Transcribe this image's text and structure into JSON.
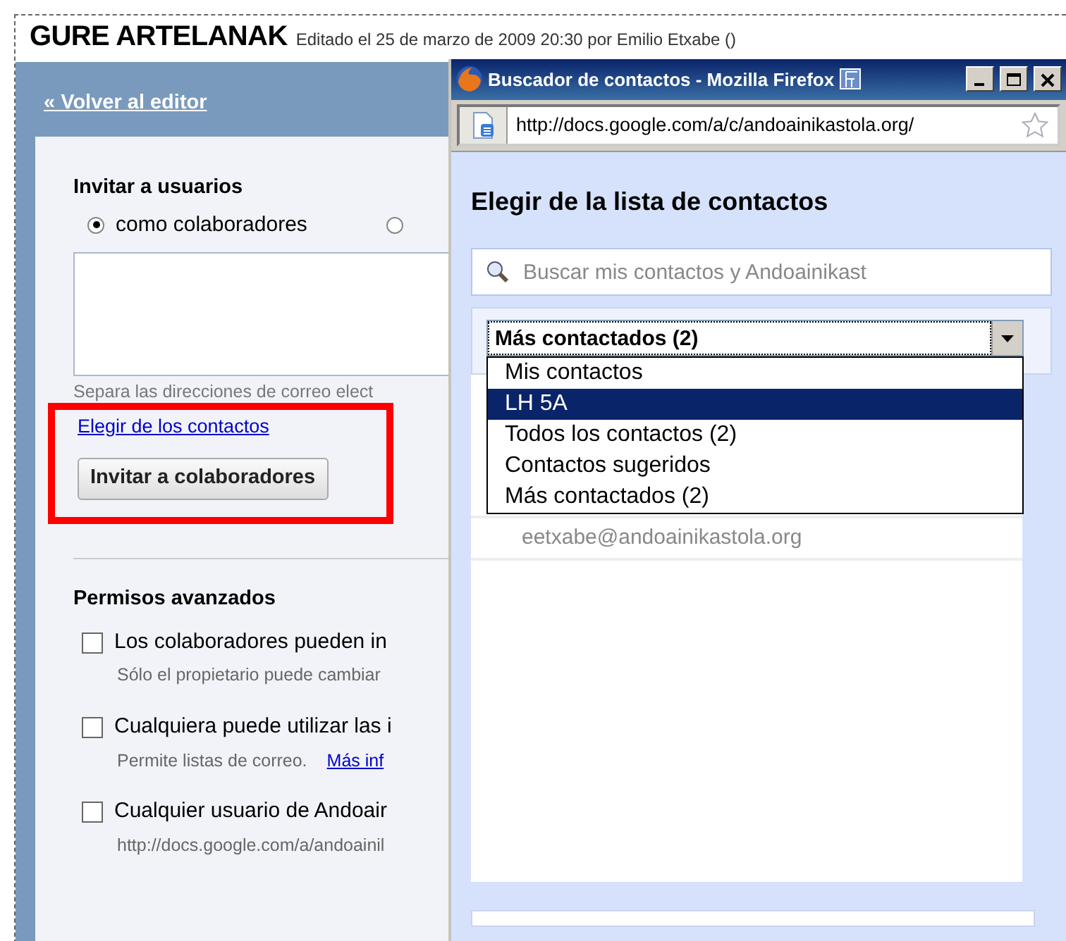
{
  "page": {
    "title": "GURE ARTELANAK",
    "edit_info": "Editado el 25 de marzo de 2009 20:30 por Emilio Etxabe ()"
  },
  "back_link": "« Volver al editor",
  "invite": {
    "heading": "Invitar a usuarios",
    "roles": [
      {
        "label": "como colaboradores",
        "selected": true
      },
      {
        "selected": false
      }
    ],
    "hint": "Separa las direcciones de correo elect",
    "choose_link": "Elegir de los contactos",
    "invite_button": "Invitar a colaboradores"
  },
  "advanced": {
    "heading": "Permisos avanzados",
    "options": [
      {
        "label": "Los colaboradores pueden in",
        "checked": false,
        "note": "Sólo el propietario puede cambiar"
      },
      {
        "label": "Cualquiera puede utilizar las i",
        "checked": false,
        "note": "Permite listas de correo.",
        "link": "Más inf"
      },
      {
        "label": "Cualquier usuario de Andoair",
        "checked": false,
        "note": "http://docs.google.com/a/andoainil"
      }
    ]
  },
  "popup": {
    "title": "Buscador de contactos - Mozilla Firefox",
    "url": "http://docs.google.com/a/c/andoainikastola.org/",
    "heading": "Elegir de la lista de contactos",
    "search": {
      "placeholder": "Buscar mis contactos y Andoainikast"
    },
    "list_select": {
      "value": "Más contactados (2)",
      "expanded": true,
      "options": [
        {
          "label": "Mis contactos",
          "highlighted": false
        },
        {
          "label": "LH 5A",
          "highlighted": true
        },
        {
          "label": "Todos los contactos (2)",
          "highlighted": false
        },
        {
          "label": "Contactos sugeridos",
          "highlighted": false
        },
        {
          "label": "Más contactados (2)",
          "highlighted": false
        }
      ]
    },
    "contacts": [
      {
        "email": "eetxabe@andoainikastola.org"
      }
    ]
  }
}
